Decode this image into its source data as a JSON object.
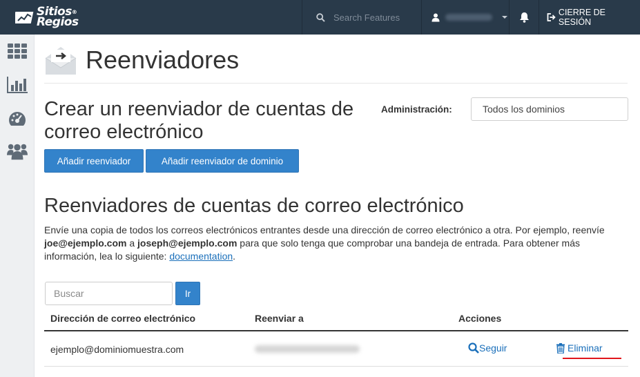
{
  "brand": {
    "line1": "Sitios",
    "line2": "Regios",
    "mark": "®"
  },
  "topbar": {
    "search_placeholder": "Search Features",
    "logout_label": "CIERRE DE SESIÓN"
  },
  "page": {
    "title": "Reenviadores"
  },
  "create_section": {
    "title": "Crear un reenviador de cuentas de correo electrónico",
    "admin_label": "Administración:",
    "domain_value": "Todos los dominios",
    "add_forwarder": "Añadir reenviador",
    "add_domain_forwarder": "Añadir reenviador de dominio"
  },
  "list_section": {
    "title": "Reenviadores de cuentas de correo electrónico",
    "desc_1": "Envíe una copia de todos los correos electrónicos entrantes desde una dirección de correo electrónico a otra. Por ejemplo, reenvíe ",
    "desc_email_1": "joe@ejemplo.com",
    "desc_2": " a ",
    "desc_email_2": "joseph@ejemplo.com",
    "desc_3": " para que solo tenga que comprobar una bandeja de entrada. Para obtener más información, lea lo siguiente: ",
    "desc_link": "documentation",
    "desc_4": ".",
    "search_placeholder": "Buscar",
    "go_label": "Ir"
  },
  "table": {
    "columns": [
      "Dirección de correo electrónico",
      "Reenviar a",
      "Acciones"
    ],
    "rows": [
      {
        "email": "ejemplo@dominiomuestra.com",
        "track": "Seguir",
        "delete": "Eliminar"
      }
    ]
  },
  "colors": {
    "topbar": "#293a4a",
    "primary": "#3383cb",
    "link": "#1a6fba",
    "highlight": "#e0151b"
  }
}
